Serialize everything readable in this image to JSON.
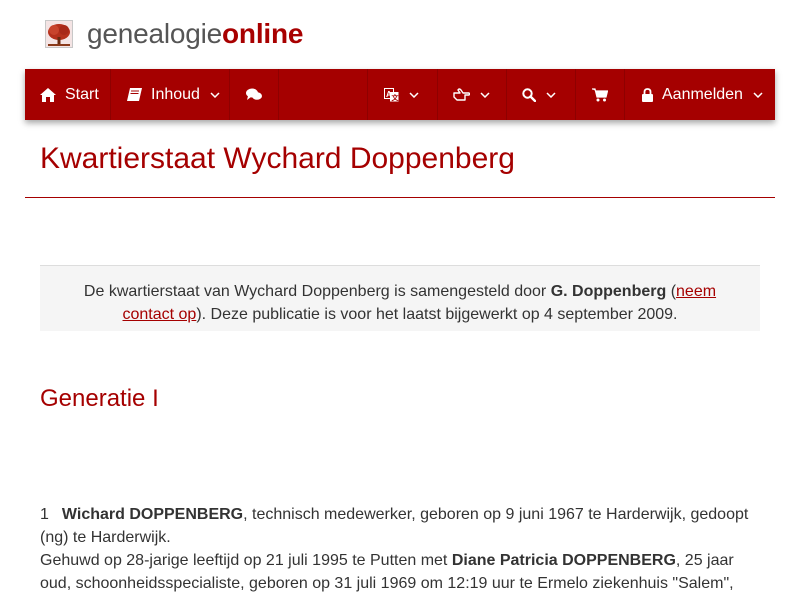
{
  "brand": {
    "part1": "genealogie",
    "part2": "online"
  },
  "nav": {
    "start": "Start",
    "inhoud": "Inhoud",
    "aanmelden": "Aanmelden"
  },
  "colors": {
    "accent": "#a50000",
    "panel": "#f5f5f5",
    "text": "#333333"
  },
  "icons": [
    "home-icon",
    "book-icon",
    "comments-icon",
    "translate-icon",
    "hand-point-icon",
    "search-icon",
    "cart-icon",
    "lock-icon",
    "chevron-down-icon"
  ],
  "page": {
    "title": "Kwartierstaat Wychard Doppenberg"
  },
  "info": {
    "text1": "De kwartierstaat van Wychard Doppenberg is samengesteld door ",
    "author": "G. Doppenberg",
    "paren_open": " (",
    "contact_a": "neem",
    "contact_b": "contact op",
    "text2": "). Deze publicatie is voor het laatst bijgewerkt op 4 september 2009."
  },
  "generation": {
    "heading": "Generatie I"
  },
  "entry": {
    "number": "1",
    "name": "Wichard DOPPENBERG",
    "line1_rest": ", technisch medewerker, geboren op 9 juni 1967 te Harderwijk, gedoopt",
    "line2": "(ng) te Harderwijk.",
    "marriage_prefix": "Gehuwd op 28-jarige leeftijd op 21 juli 1995 te Putten met ",
    "spouse": "Diane Patricia DOPPENBERG",
    "spouse_rest1": ", 25 jaar",
    "spouse_rest2": "oud, schoonheidsspecialiste, geboren op 31 juli 1969 om 12:19 uur te Ermelo ziekenhuis \"Salem\","
  }
}
